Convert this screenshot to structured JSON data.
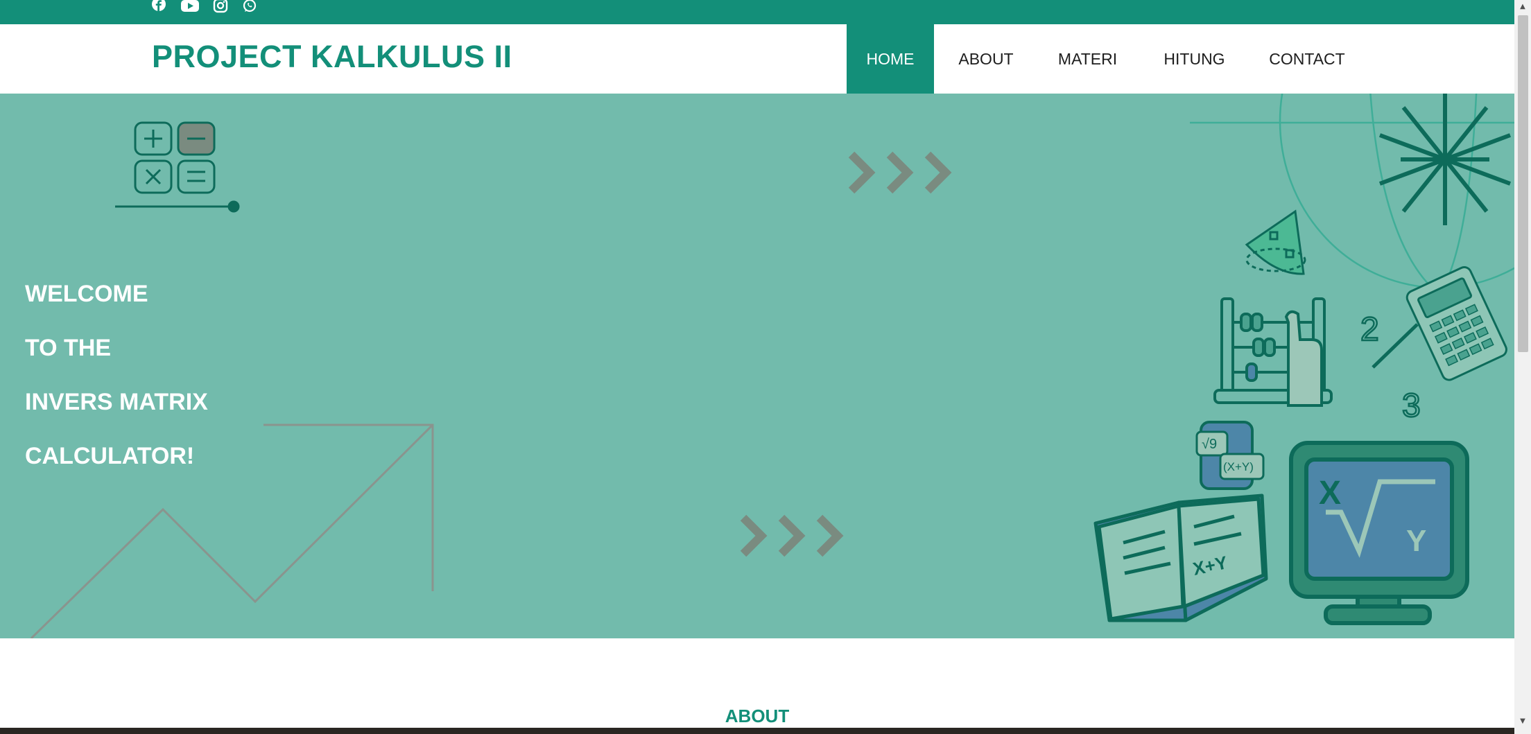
{
  "social": {
    "facebook": "facebook-icon",
    "youtube": "youtube-icon",
    "instagram": "instagram-icon",
    "whatsapp": "whatsapp-icon"
  },
  "brand": {
    "title": "PROJECT KALKULUS II"
  },
  "nav": {
    "items": [
      {
        "label": "HOME",
        "active": true
      },
      {
        "label": "ABOUT",
        "active": false
      },
      {
        "label": "MATERI",
        "active": false
      },
      {
        "label": "HITUNG",
        "active": false
      },
      {
        "label": "CONTACT",
        "active": false
      }
    ]
  },
  "hero": {
    "lines": [
      "WELCOME",
      "TO THE",
      "INVERS MATRIX",
      "CALCULATOR!"
    ],
    "illustration_labels": {
      "fraction_num": "2",
      "fraction_den": "3",
      "sqrt_badge": "√9",
      "xy_badge": "(X+Y)",
      "book_text": "X+Y",
      "screen_x": "X",
      "screen_y": "Y"
    }
  },
  "about": {
    "title": "ABOUT"
  },
  "colors": {
    "brand": "#138f79",
    "hero_bg": "#72bbac",
    "dark_teal": "#0d6b5a",
    "chevron": "#7a8b80",
    "line_gray": "#8a948e"
  }
}
